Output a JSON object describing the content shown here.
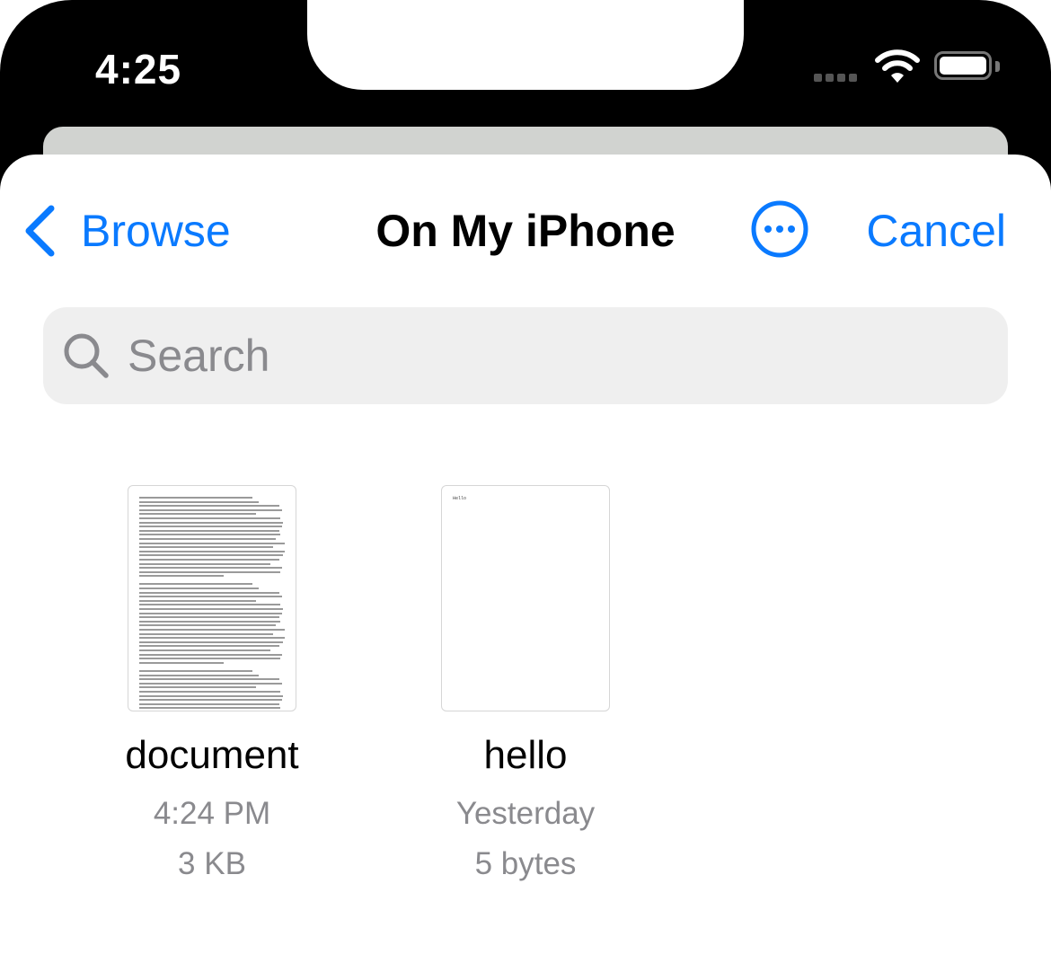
{
  "status": {
    "time": "4:25"
  },
  "nav": {
    "back_label": "Browse",
    "title": "On My iPhone",
    "cancel_label": "Cancel"
  },
  "search": {
    "placeholder": "Search"
  },
  "files": [
    {
      "name": "document",
      "date": "4:24 PM",
      "size": "3 KB"
    },
    {
      "name": "hello",
      "date": "Yesterday",
      "size": "5 bytes",
      "preview_text": "Hello"
    }
  ],
  "colors": {
    "accent": "#0a7aff",
    "secondary_text": "#8a8a8e",
    "search_bg": "#efefef"
  },
  "icons": [
    "chevron-left-icon",
    "ellipsis-circle-icon",
    "search-icon",
    "wifi-icon",
    "battery-icon",
    "cellular-icon"
  ]
}
